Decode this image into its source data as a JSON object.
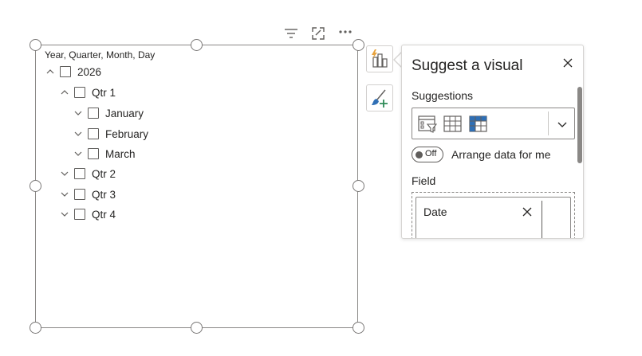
{
  "visual_header": {
    "icons": [
      "filter-icon",
      "focus-mode-icon",
      "more-options-icon"
    ]
  },
  "slicer": {
    "title": "Year, Quarter, Month, Day",
    "tree": [
      {
        "label": "2026",
        "level": 0,
        "expanded": true,
        "checked": false
      },
      {
        "label": "Qtr 1",
        "level": 1,
        "expanded": true,
        "checked": false
      },
      {
        "label": "January",
        "level": 2,
        "expanded": false,
        "checked": false
      },
      {
        "label": "February",
        "level": 2,
        "expanded": false,
        "checked": false
      },
      {
        "label": "March",
        "level": 2,
        "expanded": false,
        "checked": false
      },
      {
        "label": "Qtr 2",
        "level": 1,
        "expanded": false,
        "checked": false
      },
      {
        "label": "Qtr 3",
        "level": 1,
        "expanded": false,
        "checked": false
      },
      {
        "label": "Qtr 4",
        "level": 1,
        "expanded": false,
        "checked": false
      }
    ]
  },
  "side_toolbar": {
    "buttons": [
      "build-visual-icon",
      "format-visual-icon"
    ]
  },
  "suggest_panel": {
    "title": "Suggest a visual",
    "suggestions_label": "Suggestions",
    "suggestion_icons": [
      "slicer-icon",
      "table-icon",
      "matrix-icon"
    ],
    "toggle_state": "Off",
    "toggle_label": "Arrange data for me",
    "field_label": "Field",
    "field_value": "Date"
  },
  "colors": {
    "accent_orange": "#e8a33d",
    "accent_blue": "#2f6fb5",
    "border": "#8a8886",
    "text": "#252423"
  }
}
